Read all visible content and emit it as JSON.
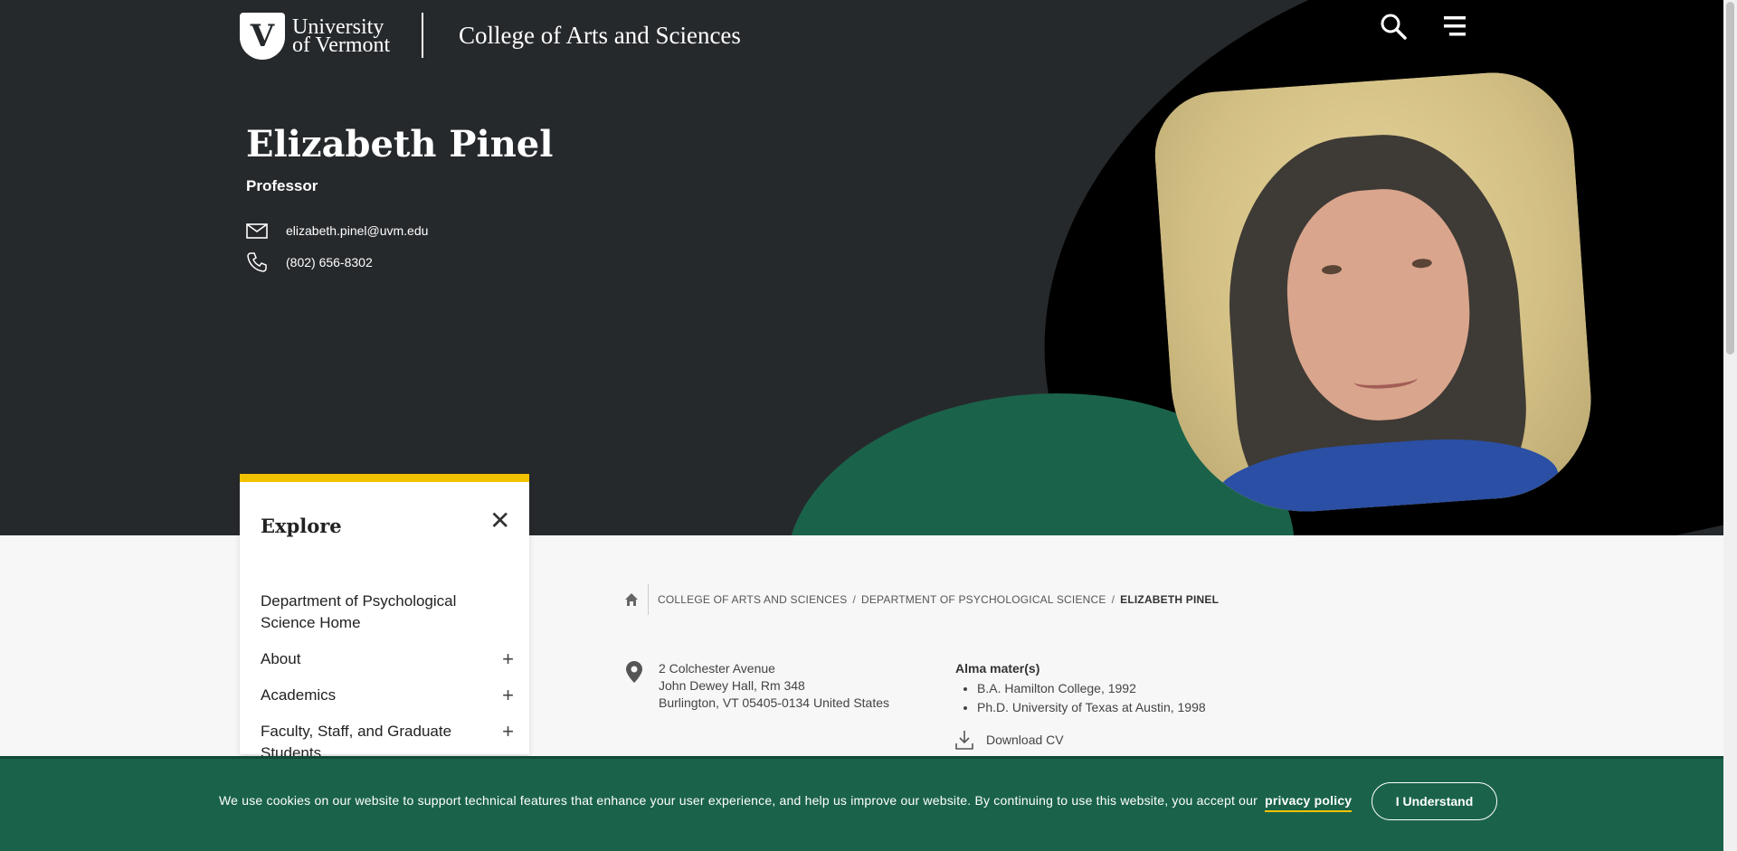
{
  "header": {
    "logo_letter": "V",
    "logo_text_line1": "University",
    "logo_text_line2": "of Vermont",
    "college": "College of Arts and Sciences",
    "search_icon": "search-icon",
    "menu_icon": "menu-icon"
  },
  "profile": {
    "name": "Elizabeth Pinel",
    "title": "Professor",
    "email": "elizabeth.pinel@uvm.edu",
    "phone": "(802) 656-8302"
  },
  "explore": {
    "title": "Explore",
    "close_icon": "close-icon",
    "items": [
      {
        "label": "Department of Psychological Science Home"
      },
      {
        "label": "About"
      },
      {
        "label": "Academics"
      },
      {
        "label": "Faculty, Staff, and Graduate Students"
      }
    ]
  },
  "breadcrumb": {
    "items": [
      "COLLEGE OF ARTS AND SCIENCES",
      "DEPARTMENT OF PSYCHOLOGICAL SCIENCE"
    ],
    "current": "ELIZABETH PINEL"
  },
  "address": {
    "line1": "2 Colchester Avenue",
    "line2": "John Dewey Hall, Rm 348",
    "line3": "Burlington, VT 05405-0134 United States"
  },
  "alma_mater": {
    "title": "Alma mater(s)",
    "items": [
      "B.A. Hamilton College, 1992",
      "Ph.D. University of Texas at Austin, 1998"
    ]
  },
  "download_cv": "Download CV",
  "cookie": {
    "text": "We use cookies on our website to support technical features that enhance your user experience, and help us improve our website. By continuing to use this website, you accept our",
    "link": "privacy policy",
    "button": "I Understand"
  },
  "colors": {
    "hero_bg": "#26292c",
    "accent_green": "#1a634a",
    "accent_gold": "#f2c200"
  }
}
